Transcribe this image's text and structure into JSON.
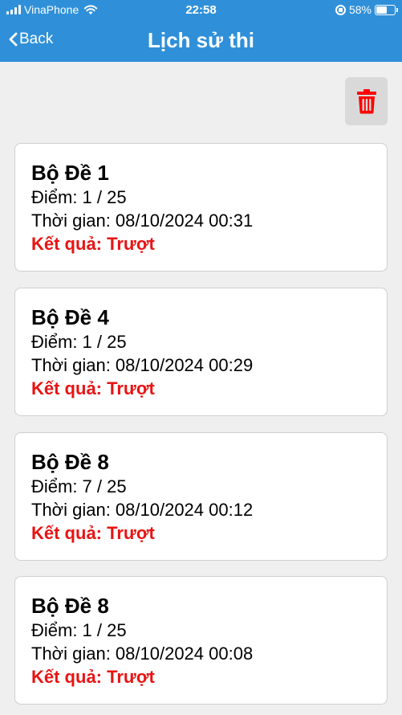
{
  "status_bar": {
    "carrier": "VinaPhone",
    "time": "22:58",
    "battery": "58%",
    "battery_level": 0.58
  },
  "nav": {
    "back_label": "Back",
    "title": "Lịch sử thi"
  },
  "actions": {
    "delete_icon": "trash-icon",
    "delete_color": "#ff0000"
  },
  "history": [
    {
      "name": "Bộ Đề 1",
      "score": "Điểm: 1 / 25",
      "time": "Thời gian: 08/10/2024 00:31",
      "result": "Kết quả: Trượt"
    },
    {
      "name": "Bộ Đề 4",
      "score": "Điểm: 1 / 25",
      "time": "Thời gian: 08/10/2024 00:29",
      "result": "Kết quả: Trượt"
    },
    {
      "name": "Bộ Đề 8",
      "score": "Điểm: 7 / 25",
      "time": "Thời gian: 08/10/2024 00:12",
      "result": "Kết quả: Trượt"
    },
    {
      "name": "Bộ Đề 8",
      "score": "Điểm: 1 / 25",
      "time": "Thời gian: 08/10/2024 00:08",
      "result": "Kết quả: Trượt"
    }
  ],
  "colors": {
    "header": "#2f90d9",
    "fail": "#e81414",
    "background": "#efefef"
  }
}
